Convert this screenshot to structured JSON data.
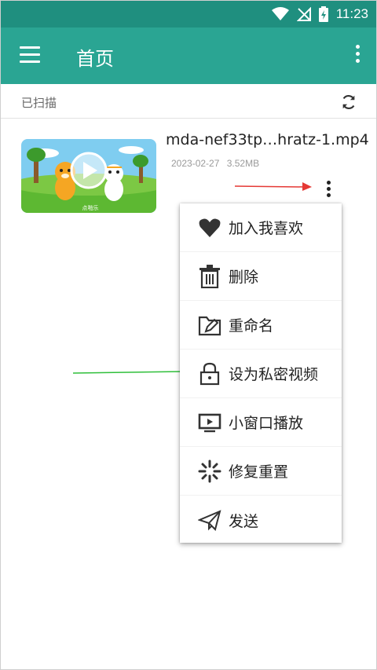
{
  "status_bar": {
    "time": "11:23"
  },
  "app_bar": {
    "title": "首页"
  },
  "sub_header": {
    "scan_label": "已扫描"
  },
  "video": {
    "title": "mda-nef33tp…hratz-1.mp4",
    "date": "2023-02-27",
    "size": "3.52MB",
    "thumb_caption": "点啪乐"
  },
  "menu": {
    "items": [
      {
        "label": "加入我喜欢",
        "icon": "heart-icon"
      },
      {
        "label": "删除",
        "icon": "trash-icon"
      },
      {
        "label": "重命名",
        "icon": "folder-edit-icon"
      },
      {
        "label": "设为私密视频",
        "icon": "lock-icon"
      },
      {
        "label": "小窗口播放",
        "icon": "picture-in-picture-icon"
      },
      {
        "label": "修复重置",
        "icon": "loading-spinner-icon"
      },
      {
        "label": "发送",
        "icon": "send-icon"
      }
    ]
  },
  "colors": {
    "status_bar": "#1f8f7f",
    "app_bar": "#2aa593",
    "arrow_red": "#e53935",
    "arrow_green": "#2fbf3a"
  }
}
